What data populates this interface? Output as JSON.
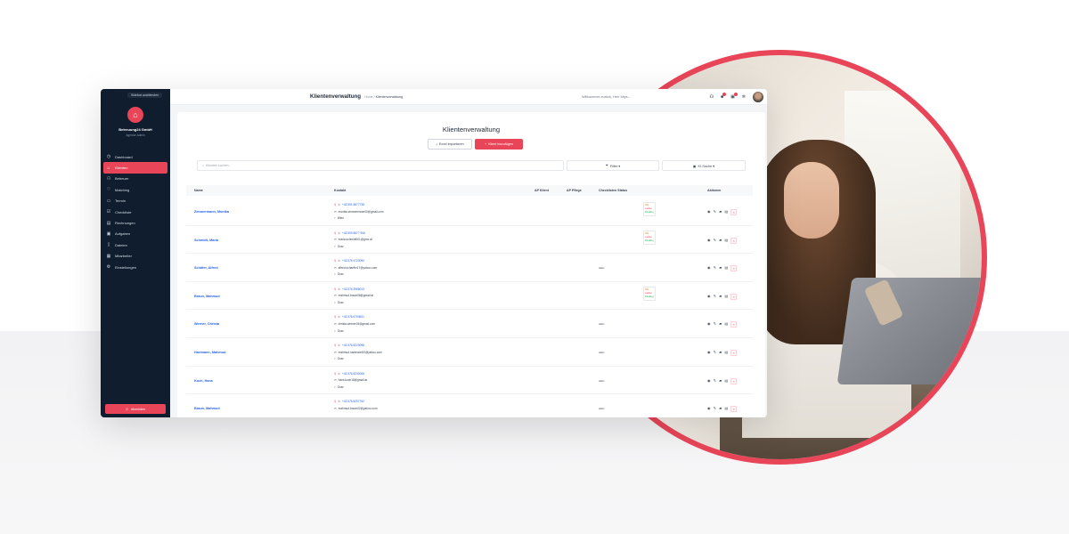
{
  "app": {
    "sidebar": {
      "collapse_label": "Sidebar ausblenden",
      "company": "Betreuung24 GmbH",
      "subtitle": "Agentur-Admin",
      "items": [
        {
          "label": "Dashboard",
          "icon": "clock-icon",
          "active": false
        },
        {
          "label": "Klienten",
          "icon": "home-icon",
          "active": true
        },
        {
          "label": "Betreuer",
          "icon": "users-icon",
          "active": false
        },
        {
          "label": "Matching",
          "icon": "heart-icon",
          "active": false
        },
        {
          "label": "Termin",
          "icon": "truck-icon",
          "active": false
        },
        {
          "label": "Checkliste",
          "icon": "checklist-icon",
          "active": false
        },
        {
          "label": "Rechnungen",
          "icon": "invoice-icon",
          "active": false
        },
        {
          "label": "Aufgaben",
          "icon": "task-icon",
          "active": false
        },
        {
          "label": "Dateien",
          "icon": "file-icon",
          "active": false
        },
        {
          "label": "Mitarbeiter",
          "icon": "staff-icon",
          "active": false
        },
        {
          "label": "Einstellungen",
          "icon": "gear-icon",
          "active": false
        }
      ],
      "logout_label": "Abmelden"
    },
    "topbar": {
      "title": "Klientenverwaltung",
      "breadcrumb_home": "Home",
      "breadcrumb_sep": "/",
      "breadcrumb_current": "Klientenverwaltung",
      "greeting": "Willkommen zurück, Herr Idrys..."
    },
    "page": {
      "heading": "Klientenverwaltung",
      "import_label": "Excel importieren",
      "add_label": "Klient hinzufügen",
      "search_placeholder": "Klienten suchen...",
      "filter_label": "Filter ▾",
      "ai_label": "KI-Suche ▾"
    },
    "table": {
      "headers": [
        "Name",
        "Kontakt",
        "AP Klient",
        "AP Pflege",
        "Checklisten Status",
        "Aktionen"
      ],
      "rows": [
        {
          "name": "Zimmermann, Monika",
          "phone": "+43 591 8877738",
          "email": "monika.zimmermann00@gmail.com",
          "city": "Wien",
          "status": "",
          "badges": [
            "Info",
            "Laufen",
            "Pending"
          ]
        },
        {
          "name": "Schmidt, Maria",
          "phone": "+43 590 8877 908",
          "email": "maria.schmidt001@gmx.at",
          "city": "Graz",
          "status": "",
          "badges": [
            "Info",
            "Laufen",
            "Pending"
          ]
        },
        {
          "name": "Schäfer, Alfred",
          "phone": "+43 576 4723090",
          "email": "alfred.schaefer17@yahoo.com",
          "city": "Graz",
          "status": "Aktiv",
          "badges": []
        },
        {
          "name": "Braun, Mahmud",
          "phone": "+43 576 3968013",
          "email": "mahmud.braun08@gmail.at",
          "city": "Graz",
          "status": "",
          "badges": [
            "Info",
            "Laufen",
            "Pending"
          ]
        },
        {
          "name": "Werner, Christa",
          "phone": "+43 576 6793621",
          "email": "christa.werner03@gmail.com",
          "city": "Graz",
          "status": "Aktiv",
          "badges": []
        },
        {
          "name": "Hartmann, Mahmud",
          "phone": "+43 576 8220098",
          "email": "mahmud.hartmann00@yahoo.com",
          "city": "Graz",
          "status": "Aktiv",
          "badges": []
        },
        {
          "name": "Koch, Hans",
          "phone": "+43 576 8230008",
          "email": "hans.koch18@gmail.at",
          "city": "Graz",
          "status": "Aktiv",
          "badges": []
        },
        {
          "name": "Braun, Mahmud",
          "phone": "+43 576 8257762",
          "email": "mahmud.braun02@yahoo.com",
          "city": "",
          "status": "Aktiv",
          "badges": []
        }
      ]
    }
  },
  "colors": {
    "accent": "#e94558",
    "sidebar": "#0f1d2e",
    "link": "#2563eb"
  }
}
